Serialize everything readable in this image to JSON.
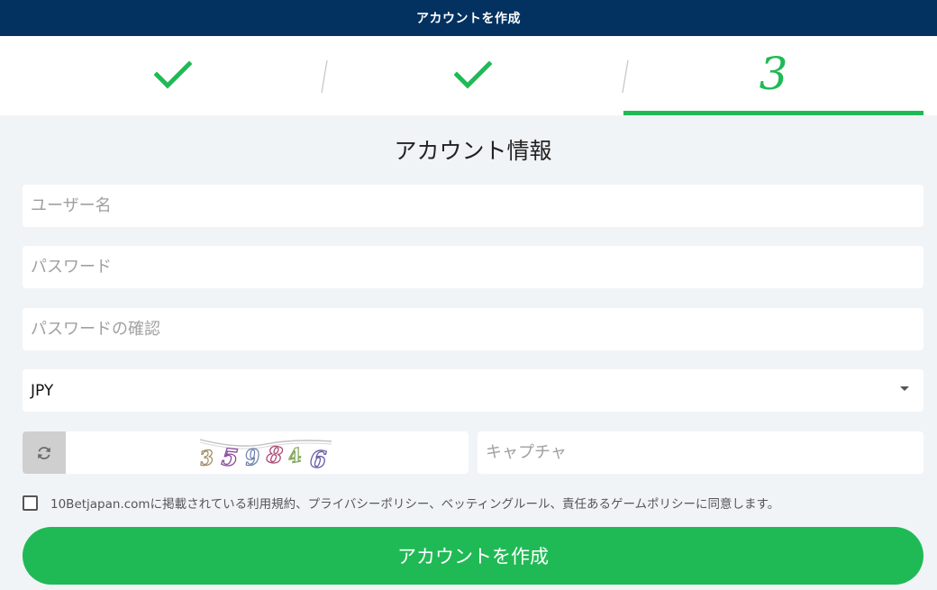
{
  "header": {
    "title": "アカウントを作成"
  },
  "steps": {
    "current_number": "3",
    "accent_color": "#1fba55",
    "completed_icon": "checkmark-icon"
  },
  "form": {
    "section_title": "アカウント情報",
    "username_placeholder": "ユーザー名",
    "password_placeholder": "パスワード",
    "confirm_password_placeholder": "パスワードの確認",
    "currency_selected": "JPY",
    "captcha_digits": [
      "3",
      "5",
      "9",
      "8",
      "4",
      "6"
    ],
    "captcha_placeholder": "キャプチャ",
    "agreement_text": "10Betjapan.comに掲載されている利用規約、プライバシーポリシー、ベッティングルール、責任あるゲームポリシーに同意します。",
    "submit_label": "アカウントを作成"
  },
  "colors": {
    "header_bg": "#033160",
    "page_bg": "#f1f4f7"
  }
}
